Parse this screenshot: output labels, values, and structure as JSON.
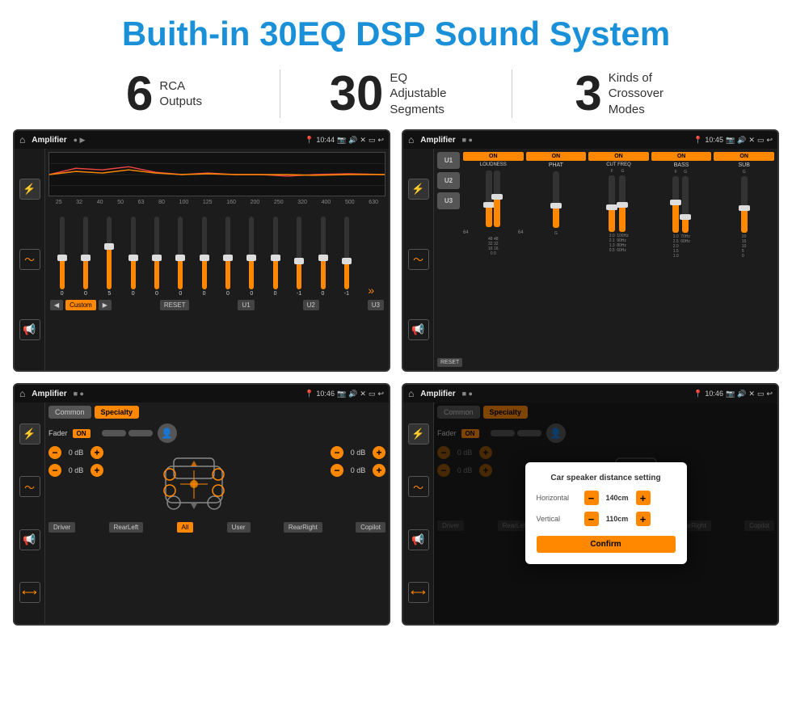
{
  "header": {
    "title": "Buith-in 30EQ DSP Sound System"
  },
  "stats": [
    {
      "number": "6",
      "label": "RCA\nOutputs"
    },
    {
      "number": "30",
      "label": "EQ Adjustable\nSegments"
    },
    {
      "number": "3",
      "label": "Kinds of\nCrossover Modes"
    }
  ],
  "screens": [
    {
      "id": "eq",
      "statusBar": {
        "title": "Amplifier",
        "time": "10:44",
        "dots": "play"
      },
      "eqFreqs": [
        "25",
        "32",
        "40",
        "50",
        "63",
        "80",
        "100",
        "125",
        "160",
        "200",
        "250",
        "320",
        "400",
        "500",
        "630"
      ],
      "eqValues": [
        "0",
        "0",
        "5",
        "0",
        "0",
        "0",
        "0",
        "0",
        "0",
        "0",
        "-1",
        "0",
        "-1"
      ],
      "sliderHeights": [
        45,
        45,
        60,
        45,
        45,
        45,
        45,
        45,
        45,
        45,
        40,
        45,
        40
      ],
      "preset": "Custom",
      "buttons": [
        "RESET",
        "U1",
        "U2",
        "U3"
      ]
    },
    {
      "id": "crossover",
      "statusBar": {
        "title": "Amplifier",
        "time": "10:45"
      },
      "presets": [
        "U1",
        "U2",
        "U3"
      ],
      "activePreset": "U1",
      "channels": [
        {
          "label": "LOUDNESS",
          "on": true
        },
        {
          "label": "PHAT",
          "on": true
        },
        {
          "label": "CUT FREQ",
          "on": true
        },
        {
          "label": "BASS",
          "on": true
        },
        {
          "label": "SUB",
          "on": true
        }
      ]
    },
    {
      "id": "fader",
      "statusBar": {
        "title": "Amplifier",
        "time": "10:46"
      },
      "tabs": [
        "Common",
        "Specialty"
      ],
      "activeTab": "Specialty",
      "faderLabel": "Fader",
      "faderOn": "ON",
      "dbValues": [
        "0 dB",
        "0 dB",
        "0 dB",
        "0 dB"
      ],
      "buttons": {
        "driver": "Driver",
        "rearLeft": "RearLeft",
        "all": "All",
        "user": "User",
        "rearRight": "RearRight",
        "copilot": "Copilot"
      }
    },
    {
      "id": "fader-dialog",
      "statusBar": {
        "title": "Amplifier",
        "time": "10:46"
      },
      "tabs": [
        "Common",
        "Specialty"
      ],
      "activeTab": "Specialty",
      "faderLabel": "Fader",
      "faderOn": "ON",
      "dialog": {
        "title": "Car speaker distance setting",
        "horizontal": {
          "label": "Horizontal",
          "value": "140cm"
        },
        "vertical": {
          "label": "Vertical",
          "value": "110cm"
        },
        "confirm": "Confirm"
      },
      "dbValues": [
        "0 dB",
        "0 dB"
      ],
      "buttons": {
        "driver": "Driver",
        "rearLeft": "RearLeft",
        "all": "All",
        "user": "User",
        "rearRight": "RearRight",
        "copilot": "Copilot"
      }
    }
  ]
}
